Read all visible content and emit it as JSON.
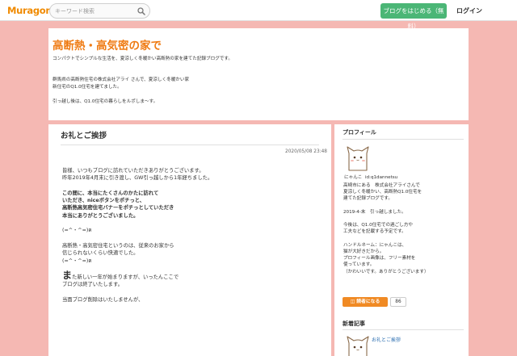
{
  "nav": {
    "logo": "Muragon",
    "search_placeholder": "キーワード検索",
    "start_button": "ブログをはじめる（無料）",
    "login": "ログイン"
  },
  "colors": {
    "page_background": "#f5b8b3",
    "title_orange": "#ef7b13",
    "start_green": "#4bb676",
    "reader_orange": "#f08a24",
    "link_blue": "#2a6db0"
  },
  "blog": {
    "title": "高断熱・高気密の家で",
    "description": [
      "コンパクトでシンプルな生活を、夏涼しく冬暖かい高断熱の家を建てた記録ブログです。",
      "",
      "",
      "群馬県の高断熱住宅の株式会社アライ さんで、夏涼しく冬暖かい家",
      "新住宅のQ1.0住宅を建てました。",
      "",
      "引っ越し後は、Q1.0住宅の暮らしをルポしま〜す。"
    ]
  },
  "post": {
    "title": "お礼とご挨拶",
    "date": "2020/05/08 23:48",
    "lines": [
      {
        "text": "皆様、いつもブログに訪れていただきありがとうございます。",
        "style": "normal"
      },
      {
        "text": "昨年2019年4月末に引き渡し、GW引っ越しから1年経ちました。",
        "style": "normal"
      },
      {
        "text": "",
        "style": "normal"
      },
      {
        "text": "この間に、本当にたくさんのかたに訪れて",
        "style": "bold"
      },
      {
        "text": "いただき、niceボタンをポチっと、",
        "style": "bold"
      },
      {
        "text": "高断熱高気密住宅バナーをポチっとしていただき",
        "style": "bold"
      },
      {
        "text": "本当にありがとうございました。",
        "style": "bold"
      },
      {
        "text": "",
        "style": "normal"
      },
      {
        "text": "(=^・^=)ฅ",
        "style": "normal"
      },
      {
        "text": "",
        "style": "normal"
      },
      {
        "text": "高断熱・高気密住宅というのは、従来のお家から",
        "style": "normal"
      },
      {
        "text": "信じられないくらい快適でした。",
        "style": "normal"
      },
      {
        "text": "(=^・^=)ฅ",
        "style": "normal"
      },
      {
        "text": "",
        "style": "normal"
      },
      {
        "big": "ま",
        "text": "た新しい一年が始まりますが、いったんここで",
        "style": "normal"
      },
      {
        "text": "ブログは終了いたします。",
        "style": "normal"
      },
      {
        "text": "",
        "style": "normal"
      },
      {
        "text": "当面ブログ削除はいたしませんが、",
        "style": "normal"
      }
    ]
  },
  "sidebar": {
    "profile_heading": "プロフィール",
    "profile_name": "にゃんこ",
    "profile_id": "id:q1dannetsu",
    "bio": [
      "高崎市にある　株式会社アライさんで",
      "夏涼しく冬暖かい、高断熱Q1.0住宅を",
      "建てた記録ブログです。",
      "",
      "2019-4-末　引っ越しました。",
      "",
      "今後は、Q1.0住宅での過ごし方や",
      "工夫などを記載する予定です。",
      "",
      "ハンドルネーム：にゃんこは、",
      "猫が大好きだから。",
      "プロフィール画像は、フリー素材を",
      "使っています。",
      "（かわいいです。ありがとうございます）"
    ],
    "reader_button": "読者になる",
    "reader_count": "86",
    "latest_heading": "新着記事",
    "latest_link": "お礼とご挨拶"
  }
}
